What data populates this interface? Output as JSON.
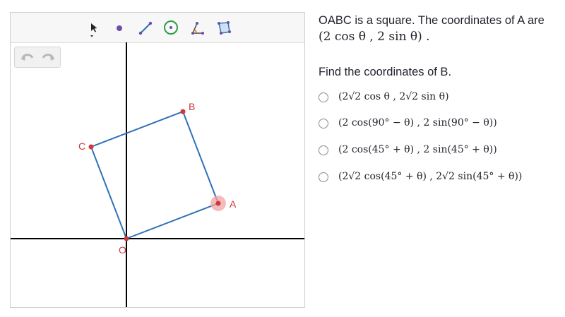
{
  "toolbar": {
    "tools": [
      {
        "icon": "pointer-arrow-icon"
      },
      {
        "icon": "point-icon"
      },
      {
        "icon": "segment-icon"
      },
      {
        "icon": "circle-icon"
      },
      {
        "icon": "angle-icon"
      },
      {
        "icon": "polygon-icon"
      }
    ]
  },
  "undo": {
    "undo_icon": "undo-icon",
    "redo_icon": "redo-icon"
  },
  "graph": {
    "points": [
      {
        "label": "O",
        "x": 0,
        "y": 0
      },
      {
        "label": "A",
        "x": 2.6,
        "y": 1.0
      },
      {
        "label": "B",
        "x": 1.6,
        "y": 3.6
      },
      {
        "label": "C",
        "x": -1.0,
        "y": 2.6
      }
    ],
    "colors": {
      "line": "#2e71b8",
      "point": "#d0363a",
      "label": "#d0363a",
      "highlight": "#f3a3a3",
      "axis": "#000000"
    }
  },
  "question": {
    "prompt": "OABC is a square. The coordinates of A are",
    "coords": "(2 cos θ , 2 sin θ) .",
    "find": "Find the coordinates of B.",
    "choices": [
      "(2√2 cos θ , 2√2 sin θ)",
      "(2 cos(90° − θ) , 2 sin(90° − θ))",
      "(2 cos(45° + θ) , 2 sin(45° + θ))",
      "(2√2 cos(45° + θ) , 2√2 sin(45° + θ))"
    ]
  }
}
